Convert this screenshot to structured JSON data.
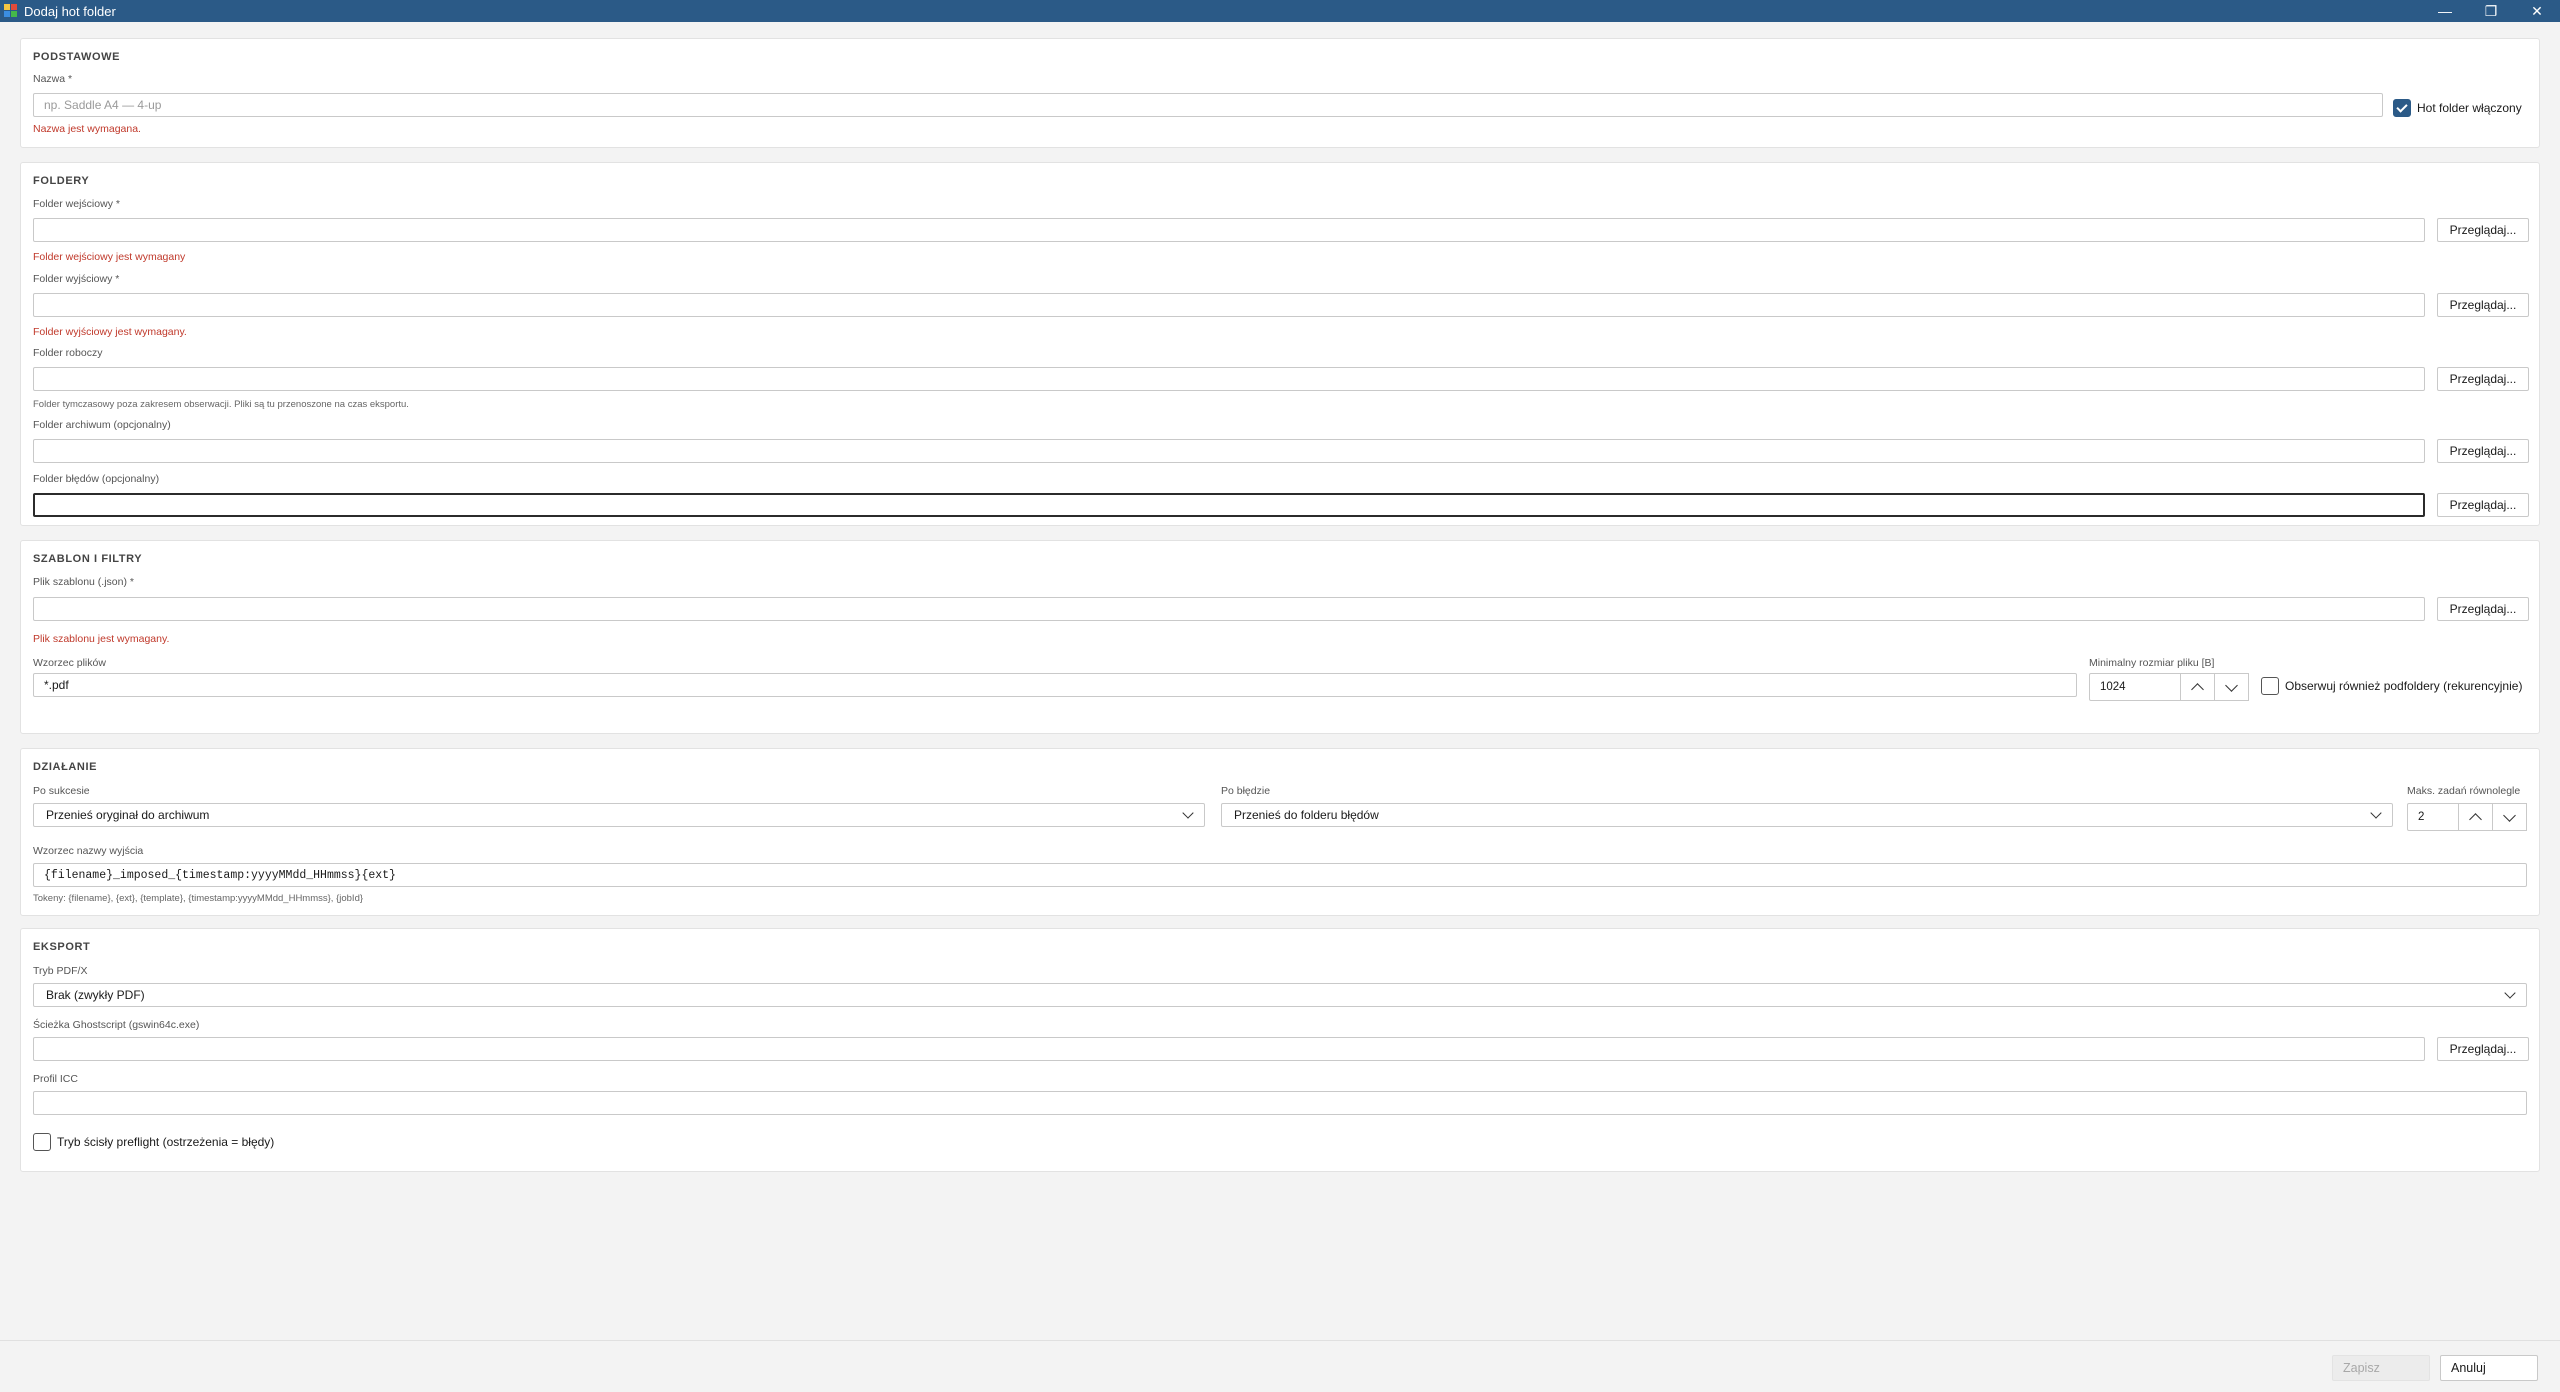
{
  "window": {
    "title": "Dodaj hot folder",
    "minimize": "—",
    "maximize": "❐",
    "close": "✕"
  },
  "basic": {
    "title": "PODSTAWOWE",
    "name_label": "Nazwa *",
    "name_placeholder": "np. Saddle A4 — 4-up",
    "name_error": "Nazwa jest wymagana.",
    "enabled_label": "Hot folder włączony",
    "enabled_checked": true
  },
  "folders": {
    "title": "FOLDERY",
    "browse_label": "Przeglądaj...",
    "input_label": "Folder wejściowy *",
    "input_error": "Folder wejściowy jest wymagany",
    "output_label": "Folder wyjściowy *",
    "output_error": "Folder wyjściowy jest wymagany.",
    "work_label": "Folder roboczy",
    "work_hint": "Folder tymczasowy poza zakresem obserwacji. Pliki są tu przenoszone na czas eksportu.",
    "archive_label": "Folder archiwum (opcjonalny)",
    "errors_label": "Folder błędów (opcjonalny)"
  },
  "template": {
    "title": "SZABLON I FILTRY",
    "file_label": "Plik szablonu (.json) *",
    "file_error": "Plik szablonu jest wymagany.",
    "pattern_label": "Wzorzec plików",
    "pattern_value": "*.pdf",
    "minsize_label": "Minimalny rozmiar pliku [B]",
    "minsize_value": "1024",
    "recursive_label": "Obserwuj również podfoldery (rekurencyjnie)"
  },
  "action": {
    "title": "DZIAŁANIE",
    "success_label": "Po sukcesie",
    "success_value": "Przenieś oryginał do archiwum",
    "error_label": "Po błędzie",
    "error_value": "Przenieś do folderu błędów",
    "parallel_label": "Maks. zadań równolegle",
    "parallel_value": "2",
    "naming_label": "Wzorzec nazwy wyjścia",
    "naming_value": "{filename}_imposed_{timestamp:yyyyMMdd_HHmmss}{ext}",
    "tokens_hint": "Tokeny: {filename}, {ext}, {template}, {timestamp:yyyyMMdd_HHmmss}, {jobId}"
  },
  "export": {
    "title": "EKSPORT",
    "pdfx_label": "Tryb PDF/X",
    "pdfx_value": "Brak (zwykły PDF)",
    "gs_label": "Ścieżka Ghostscript (gswin64c.exe)",
    "icc_label": "Profil ICC",
    "strict_label": "Tryb ścisły preflight (ostrzeżenia = błędy)"
  },
  "footer": {
    "save_label": "Zapisz",
    "cancel_label": "Anuluj"
  }
}
